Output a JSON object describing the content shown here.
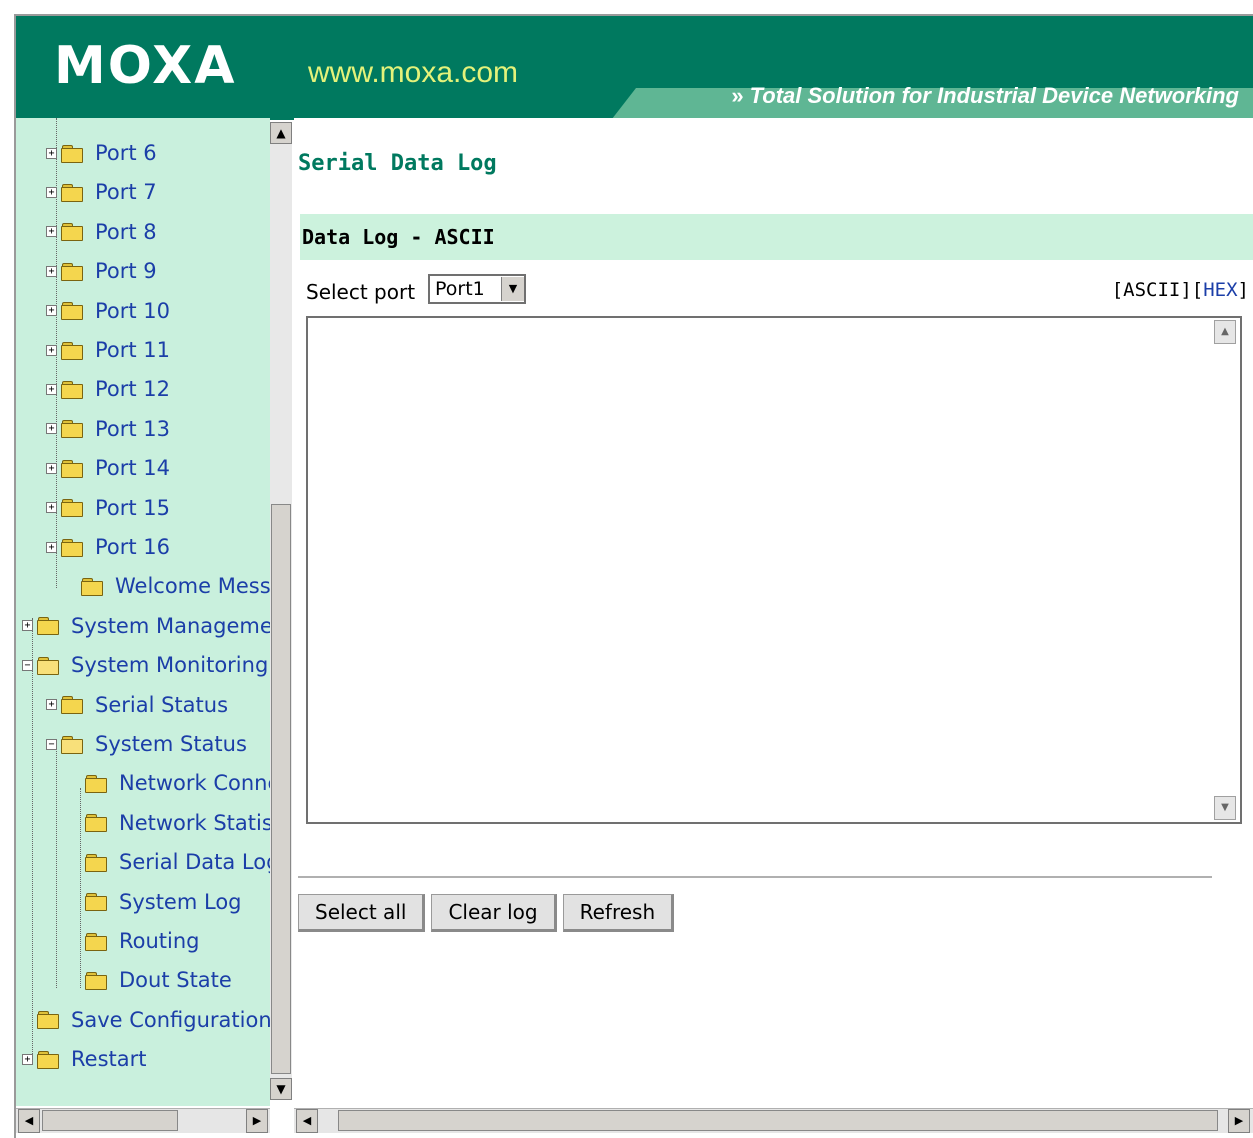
{
  "header": {
    "logo": "MOXA",
    "url": "www.moxa.com",
    "tagline_arrows": "»",
    "tagline": "Total Solution for Industrial Device Networking"
  },
  "tree": [
    {
      "label": "Port 6",
      "expander": "+"
    },
    {
      "label": "Port 7",
      "expander": "+"
    },
    {
      "label": "Port 8",
      "expander": "+"
    },
    {
      "label": "Port 9",
      "expander": "+"
    },
    {
      "label": "Port 10",
      "expander": "+"
    },
    {
      "label": "Port 11",
      "expander": "+"
    },
    {
      "label": "Port 12",
      "expander": "+"
    },
    {
      "label": "Port 13",
      "expander": "+"
    },
    {
      "label": "Port 14",
      "expander": "+"
    },
    {
      "label": "Port 15",
      "expander": "+"
    },
    {
      "label": "Port 16",
      "expander": "+"
    },
    {
      "label": "Welcome Messag",
      "expander": ""
    },
    {
      "label": "System Managemer",
      "expander": "+"
    },
    {
      "label": "System Monitoring",
      "expander": "−"
    },
    {
      "label": "Serial Status",
      "expander": "+"
    },
    {
      "label": "System Status",
      "expander": "−"
    },
    {
      "label": "Network Conne",
      "expander": ""
    },
    {
      "label": "Network Statis",
      "expander": ""
    },
    {
      "label": "Serial Data Log",
      "expander": ""
    },
    {
      "label": "System Log",
      "expander": ""
    },
    {
      "label": "Routing",
      "expander": ""
    },
    {
      "label": "Dout State",
      "expander": ""
    },
    {
      "label": "Save Configuration",
      "expander": ""
    },
    {
      "label": "Restart",
      "expander": "+"
    }
  ],
  "main": {
    "page_title": "Serial Data Log",
    "section_title": "Data Log - ASCII",
    "select_label": "Select port",
    "select_value": "Port1",
    "mode_ascii": "[ASCII]",
    "mode_hex_open": "[",
    "mode_hex": "HEX",
    "mode_hex_close": "]",
    "log_content": "",
    "buttons": {
      "select_all": "Select all",
      "clear_log": "Clear log",
      "refresh": "Refresh"
    }
  },
  "glyphs": {
    "up": "▲",
    "down": "▼",
    "left": "◀",
    "right": "▶"
  },
  "colors": {
    "brand_green": "#00795f",
    "sidebar_bg": "#c9f0dd",
    "link_blue": "#1b3ea8",
    "url_yellow": "#e4f27a"
  }
}
